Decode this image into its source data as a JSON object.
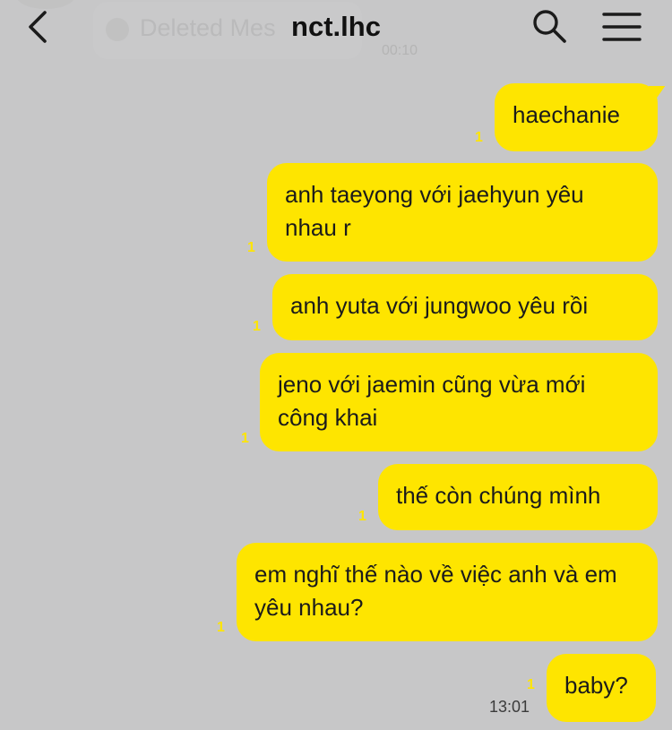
{
  "header": {
    "title": "nct.lhc",
    "deleted_preview": "Deleted Mes",
    "deleted_time": "00:10"
  },
  "messages": [
    {
      "text": "haechanie",
      "unread": "1"
    },
    {
      "text": "anh taeyong với jaehyun yêu nhau r",
      "unread": "1"
    },
    {
      "text": "anh yuta với jungwoo yêu rồi",
      "unread": "1"
    },
    {
      "text": "jeno với jaemin cũng vừa mới công khai",
      "unread": "1"
    },
    {
      "text": "thế còn chúng mình",
      "unread": "1"
    },
    {
      "text": "em nghĩ thế nào về việc anh và em yêu nhau?",
      "unread": "1"
    },
    {
      "text": "baby?",
      "unread": "1",
      "time": "13:01"
    }
  ],
  "colors": {
    "background": "#c7c7c8",
    "bubble": "#fee500",
    "unread": "#fee500"
  }
}
